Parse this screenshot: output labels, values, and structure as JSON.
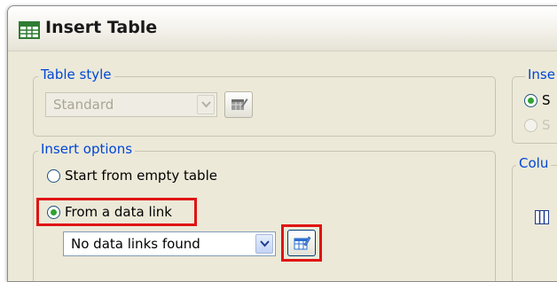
{
  "window": {
    "title": "Insert Table"
  },
  "table_style": {
    "legend": "Table style",
    "selected": "Standard"
  },
  "insert_options": {
    "legend": "Insert options",
    "option_empty": "Start from empty table",
    "option_datalink": "From a data link",
    "datalink_selected": "No data links found",
    "selected_option": "From a data link"
  },
  "right_panel": {
    "insertion_legend": "Inse",
    "radio1_label": "S",
    "radio2_label": "S",
    "columns_legend": "Colu"
  },
  "colors": {
    "legend_text": "#0046d5",
    "highlight": "#e01414",
    "dialog_bg": "#ece9d8"
  }
}
